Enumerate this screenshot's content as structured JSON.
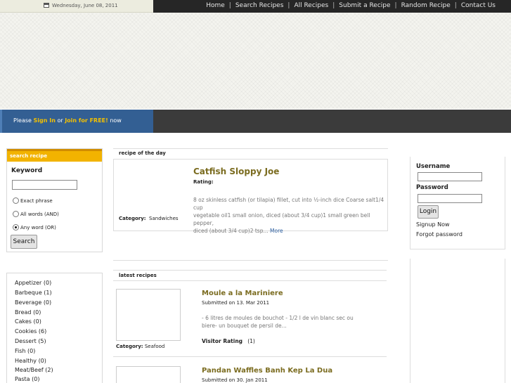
{
  "header": {
    "date": "Wednesday, June 08, 2011",
    "nav": [
      "Home",
      "Search Recipes",
      "All Recipes",
      "Submit a Recipe",
      "Random Recipe",
      "Contact Us"
    ]
  },
  "signbar": {
    "prefix": "Please",
    "sign_in": "Sign In",
    "or": "or",
    "join": "Join for FREE!",
    "suffix": "now"
  },
  "search": {
    "title": "search recipe",
    "keyword_label": "Keyword",
    "keyword_value": "",
    "options": [
      "Exact phrase",
      "All words (AND)",
      "Any word (OR)"
    ],
    "selected_option": 2,
    "button": "Search"
  },
  "categories": [
    {
      "name": "Appetizer",
      "count": "(0)"
    },
    {
      "name": "Barbeque",
      "count": "(1)"
    },
    {
      "name": "Beverage",
      "count": "(0)"
    },
    {
      "name": "Bread",
      "count": "(0)"
    },
    {
      "name": "Cakes",
      "count": "(0)"
    },
    {
      "name": "Cookies",
      "count": "(6)"
    },
    {
      "name": "Dessert",
      "count": "(5)"
    },
    {
      "name": "Fish",
      "count": "(0)"
    },
    {
      "name": "Healthy",
      "count": "(0)"
    },
    {
      "name": "Meat/Beef",
      "count": "(2)"
    },
    {
      "name": "Pasta",
      "count": "(0)"
    }
  ],
  "recipe_of_day": {
    "heading": "recipe of the day",
    "title": "Catfish Sloppy Joe",
    "rating_label": "Rating:",
    "description_l1": "8 oz skinless catfish (or tilapia) fillet, cut into ½-inch dice Coarse salt1/4 cup",
    "description_l2": "vegetable oil1 small onion, diced (about 3/4 cup)1 small green bell pepper,",
    "description_l3": "diced (about 3/4 cup)2 tsp...",
    "more": "More",
    "category_label": "Category:",
    "category": "Sandwiches"
  },
  "latest": {
    "heading": "latest recipes",
    "items": [
      {
        "title": "Moule a la Mariniere",
        "submitted": "Submitted on 13. Mar 2011",
        "desc_l1": "- 6 litres de moules de bouchot - 1/2 l de vin blanc sec ou",
        "desc_l2": "biere- un bouquet de persil de...",
        "visitor_rating_label": "Visitor Rating",
        "visitor_rating": "(1)",
        "category_label": "Category:",
        "category": "Seafood"
      },
      {
        "title": "Pandan Waffles Banh Kep La Dua",
        "submitted": "Submitted on 30. Jan 2011"
      }
    ]
  },
  "login": {
    "username_label": "Username",
    "username_value": "",
    "password_label": "Password",
    "password_value": "",
    "button": "Login",
    "signup": "Signup Now",
    "forgot": "Forgot password"
  }
}
